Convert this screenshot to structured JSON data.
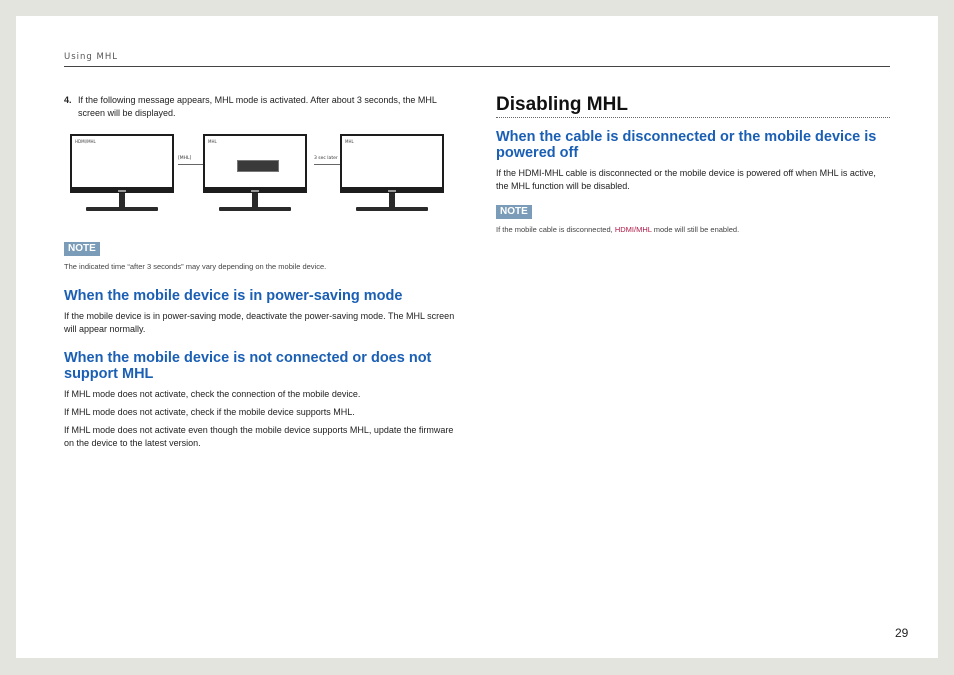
{
  "header": {
    "running_title": "Using MHL"
  },
  "left": {
    "step": {
      "number": "4.",
      "text": "If the following message appears, MHL mode is activated. After about 3 seconds, the MHL screen will be displayed."
    },
    "figure": {
      "screen1_label": "HDMI/MHL",
      "arrow1_label": "[MHL]",
      "screen2_label": "MHL",
      "arrow2_label": "3 sec later",
      "screen3_label": "MHL"
    },
    "note1": {
      "badge": "NOTE",
      "text": "The indicated time “after 3 seconds” may vary depending on the mobile device."
    },
    "section1": {
      "heading": "When the mobile device is in power-saving mode",
      "text": "If the mobile device is in power-saving mode, deactivate the power-saving mode. The MHL screen will appear normally."
    },
    "section2": {
      "heading": "When the mobile device is not connected or does not support MHL",
      "p1": "If MHL mode does not activate, check the connection of the mobile device.",
      "p2": "If MHL mode does not activate, check if the mobile device supports MHL.",
      "p3": "If MHL mode does not activate even though the mobile device supports MHL, update the firmware on the device to the latest version."
    }
  },
  "right": {
    "title": "Disabling MHL",
    "section": {
      "heading": "When the cable is disconnected or the mobile device is powered off",
      "text": "If the HDMI-MHL cable is disconnected or the mobile device is powered off when MHL is active, the MHL function will be disabled."
    },
    "note": {
      "badge": "NOTE",
      "text_before": "If the mobile cable is disconnected, ",
      "highlight": "HDMI/MHL",
      "text_after": " mode will still be enabled."
    }
  },
  "footer": {
    "page_number": "29"
  },
  "colors": {
    "heading_blue": "#1a5fb4",
    "note_badge": "#7a9cb8",
    "highlight": "#b01848"
  }
}
